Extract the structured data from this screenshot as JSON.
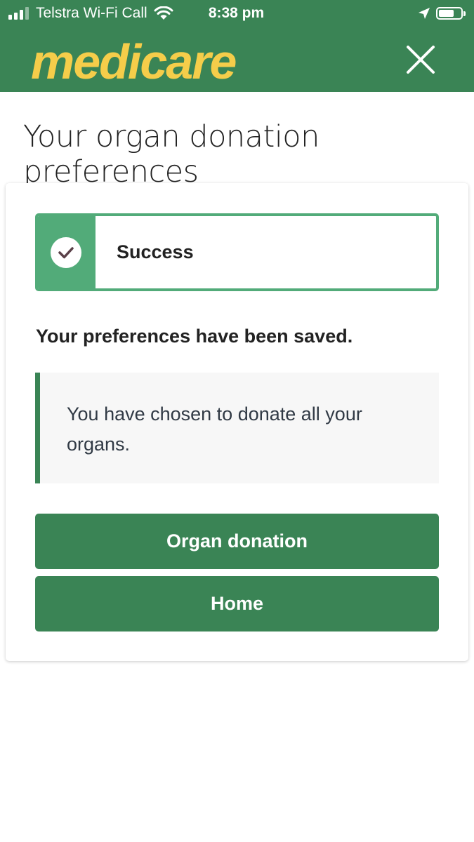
{
  "status_bar": {
    "carrier": "Telstra Wi-Fi Call",
    "time": "8:38 pm",
    "icons": [
      "signal-icon",
      "wifi-icon",
      "location-arrow-icon",
      "battery-icon"
    ],
    "signal_bars_filled": 3,
    "signal_bars_total": 4
  },
  "header": {
    "logo": "medicare",
    "close_icon": "close-icon",
    "background_color": "#3a8455",
    "logo_color": "#f5cd4a"
  },
  "page": {
    "title": "Your organ donation preferences"
  },
  "alert": {
    "label": "Success",
    "icon": "check-circle-icon",
    "accent_color": "#52ab79"
  },
  "message": {
    "saved": "Your preferences have been saved.",
    "detail": "You have chosen to donate all your organs."
  },
  "buttons": {
    "organ_donation": "Organ donation",
    "home": "Home",
    "color": "#3a8455"
  }
}
